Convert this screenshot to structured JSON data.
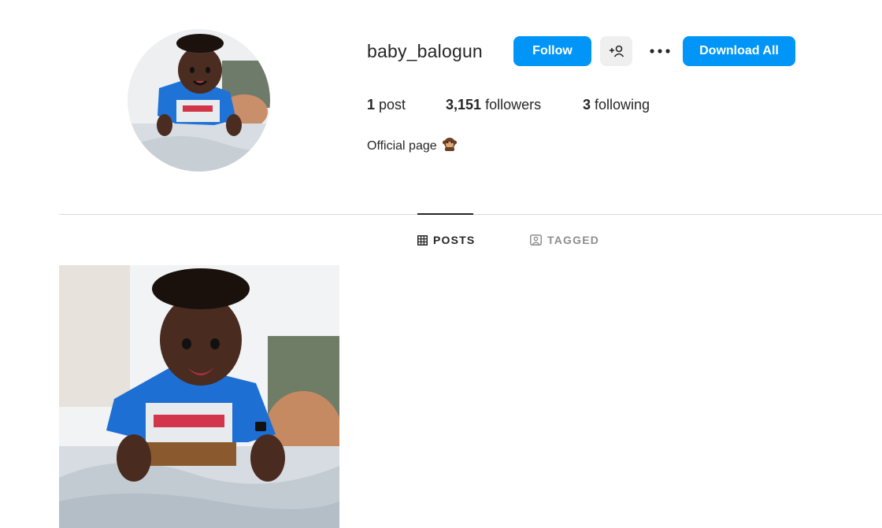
{
  "profile": {
    "username": "baby_balogun",
    "bio_text": "Official page",
    "bio_emoji_icon": "monkey-emoji-icon"
  },
  "actions": {
    "follow_label": "Follow",
    "suggest_icon": "add-person-icon",
    "more_icon": "more-horizontal-icon",
    "download_all_label": "Download All"
  },
  "stats": {
    "posts_count": "1",
    "posts_label": "post",
    "followers_count": "3,151",
    "followers_label": "followers",
    "following_count": "3",
    "following_label": "following"
  },
  "tabs": [
    {
      "label": "POSTS",
      "icon": "grid-icon",
      "active": true
    },
    {
      "label": "TAGGED",
      "icon": "tagged-icon",
      "active": false
    }
  ],
  "colors": {
    "primary_button": "#0095f6",
    "secondary_button": "#efefef",
    "text": "#262626",
    "muted_text": "#8e8e8e",
    "divider": "#dbdbdb"
  }
}
